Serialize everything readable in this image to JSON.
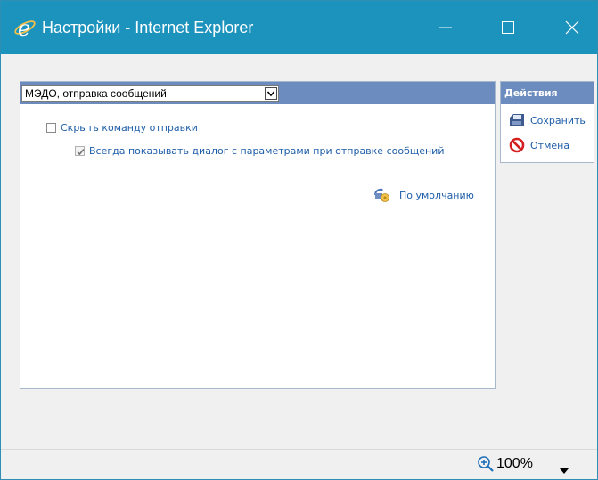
{
  "window": {
    "title": "Настройки - Internet Explorer",
    "icon": "internet-explorer-icon",
    "controls": [
      "minimize-icon",
      "maximize-icon",
      "close-icon"
    ],
    "titlebar_color": "#1c93bd"
  },
  "main": {
    "selected_option": "МЭДО, отправка сообщений",
    "checkboxes": [
      {
        "label": "Скрыть команду отправки",
        "checked": false
      },
      {
        "label": "Всегда показывать диалог с параметрами при отправке сообщений",
        "checked": true
      }
    ],
    "default_link": {
      "label": "По умолчанию",
      "icon": "reset-defaults-icon"
    },
    "header_color": "#6c8bbe"
  },
  "actions": {
    "title": "Действия",
    "items": [
      {
        "label": "Сохранить",
        "icon": "save-disk-icon"
      },
      {
        "label": "Отмена",
        "icon": "cancel-icon"
      }
    ]
  },
  "statusbar": {
    "zoom": "100%",
    "zoom_icon": "zoom-in-icon"
  }
}
